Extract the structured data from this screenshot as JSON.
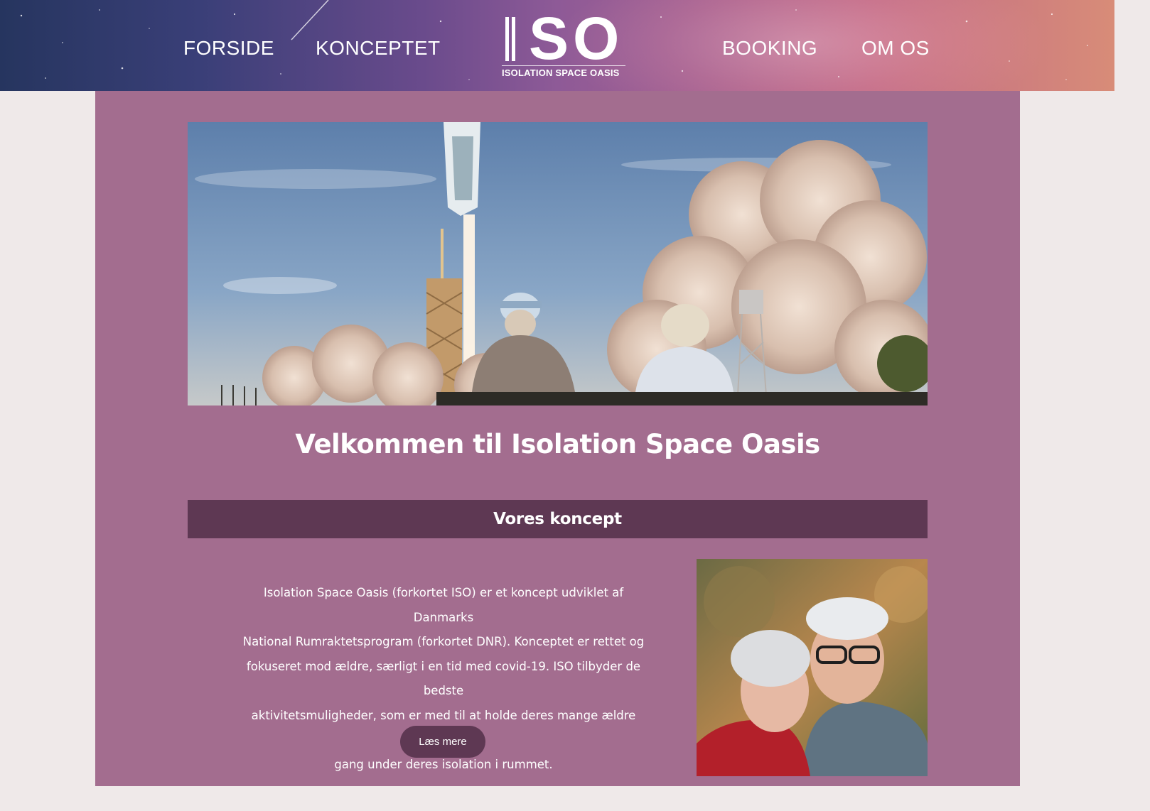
{
  "header": {
    "nav": {
      "forside": "FORSIDE",
      "konceptet": "KONCEPTET",
      "booking": "BOOKING",
      "om_os": "OM OS"
    },
    "logo": {
      "mark": "SO",
      "subtitle": "ISOLATION SPACE OASIS"
    }
  },
  "hero_image": {
    "description": "",
    "icon": "rocket-launch-photo"
  },
  "main": {
    "welcome_title": "Velkommen til Isolation Space Oasis",
    "concept": {
      "heading": "Vores koncept",
      "lines": [
        "Isolation Space Oasis (forkortet ISO) er et koncept udviklet af Danmarks",
        "National Rumraktetsprogram (forkortet DNR). Konceptet er rettet og",
        "fokuseret mod ældre, særligt i en tid med covid-19. ISO tilbyder de bedste",
        "aktivitetsmuligheder, som er med til at holde deres mange ældre gæster i",
        "gang under deres isolation i rummet."
      ],
      "read_more_label": "Læs mere"
    }
  },
  "colors": {
    "page_bg": "#efe9e9",
    "panel_bg": "#a36d8f",
    "concept_bar_bg": "#5e3853",
    "button_bg": "#5e3853"
  }
}
